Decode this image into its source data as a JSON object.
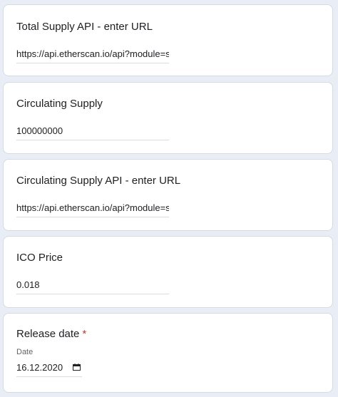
{
  "questions": [
    {
      "title": "Total Supply API - enter URL",
      "value": "https://api.etherscan.io/api?module=stats&ac"
    },
    {
      "title": "Circulating Supply",
      "value": "100000000"
    },
    {
      "title": "Circulating Supply API - enter URL",
      "value": "https://api.etherscan.io/api?module=stats&ac"
    },
    {
      "title": "ICO Price",
      "value": "0.018"
    }
  ],
  "release": {
    "title": "Release date",
    "required_marker": "*",
    "sublabel": "Date",
    "value": "16.12.2020",
    "icon": "calendar-icon"
  },
  "colors": {
    "page_background": "#e9eef6",
    "card_background": "#ffffff",
    "required": "#d93025"
  }
}
